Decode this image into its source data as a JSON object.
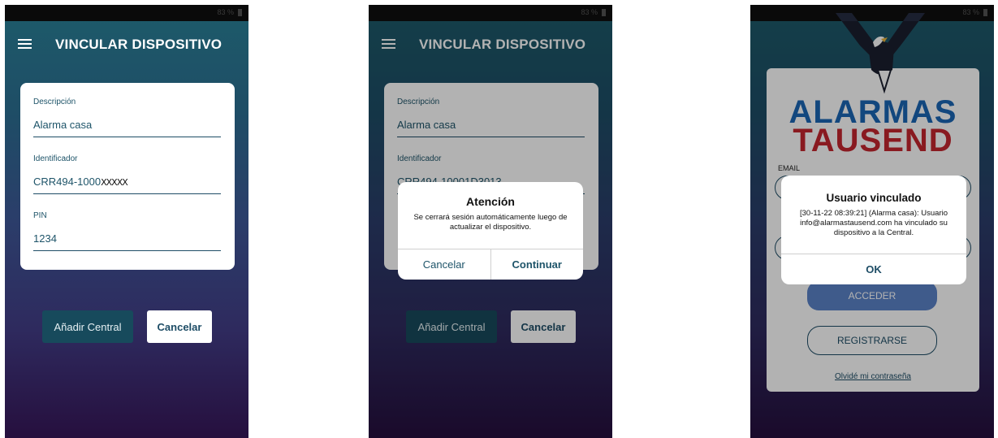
{
  "status_bar": {
    "battery_text": "83 %"
  },
  "screen1": {
    "title": "VINCULAR DISPOSITIVO",
    "fields": [
      {
        "label": "Descripción",
        "value": "Alarma casa"
      },
      {
        "label": "Identificador",
        "value": "CRR494-1000"
      },
      {
        "label": "PIN",
        "value": "1234"
      }
    ],
    "add_button": "Añadir Central",
    "cancel_button": "Cancelar"
  },
  "screen2": {
    "title": "VINCULAR DISPOSITIVO",
    "fields": [
      {
        "label": "Descripción",
        "value": "Alarma casa"
      },
      {
        "label": "Identificador",
        "value": "CRR494-10001D3013"
      }
    ],
    "add_button": "Añadir Central",
    "cancel_button": "Cancelar",
    "dialog": {
      "title": "Atención",
      "message": "Se cerrará sesión automáticamente luego de actualizar el dispositivo.",
      "cancel": "Cancelar",
      "confirm": "Continuar"
    }
  },
  "screen3": {
    "brand_line1": "ALARMAS",
    "brand_line2": "TAUSEND",
    "email_label": "EMAIL",
    "login_button": "ACCEDER",
    "register_button": "REGISTRARSE",
    "forgot_link": "Olvidé mi contraseña",
    "dialog": {
      "title": "Usuario vinculado",
      "message": "[30-11-22 08:39:21] (Alarma casa): Usuario info@alarmastausend.com ha vinculado su dispositivo a la Central.",
      "ok": "OK"
    }
  },
  "colors": {
    "brand_blue": "#1b66b5",
    "brand_red": "#c4262e",
    "teal": "#1e4d66"
  }
}
